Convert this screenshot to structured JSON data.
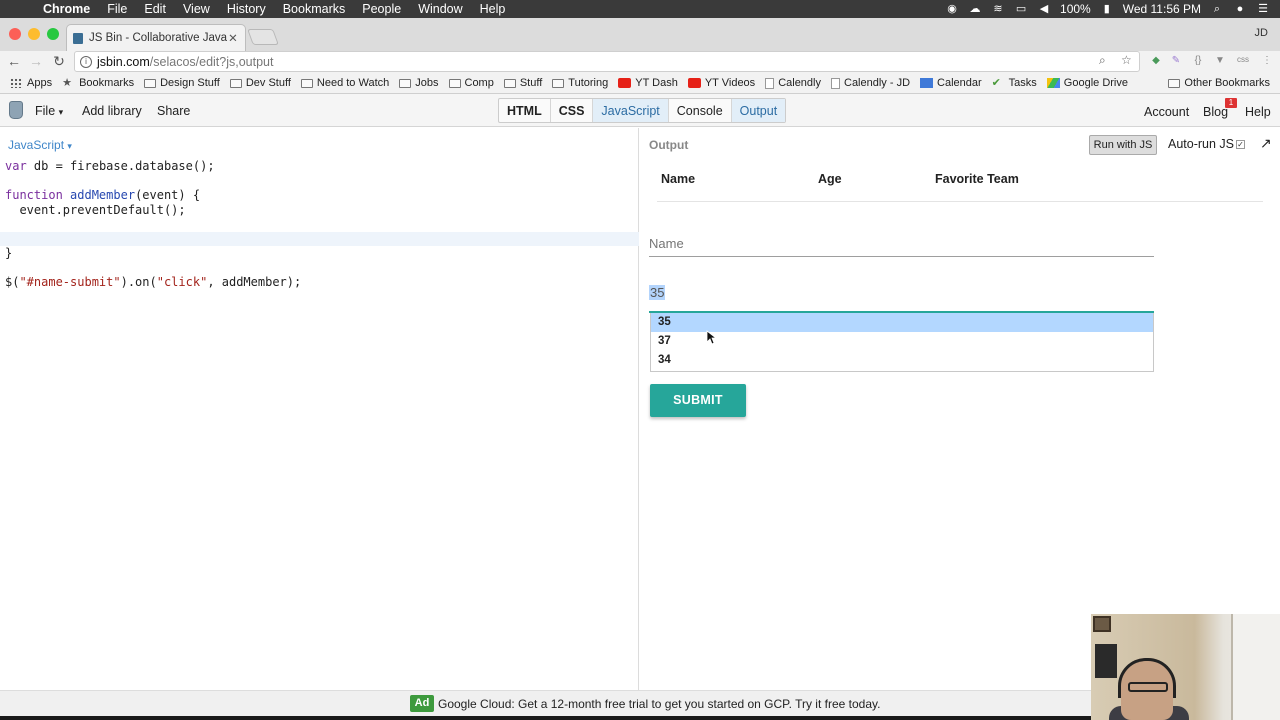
{
  "menubar": {
    "app": "Chrome",
    "items": [
      "File",
      "Edit",
      "View",
      "History",
      "Bookmarks",
      "People",
      "Window",
      "Help"
    ],
    "battery": "100%",
    "clock": "Wed 11:56 PM"
  },
  "browser": {
    "tab_title": "JS Bin - Collaborative JavaScr",
    "profile": "JD",
    "url_host": "jsbin.com",
    "url_path": "/selacos/edit?js,output"
  },
  "bookmarks": [
    {
      "label": "Apps",
      "icon": "apps-grid-icon"
    },
    {
      "label": "Bookmarks",
      "icon": "star-icon"
    },
    {
      "label": "Design Stuff",
      "icon": "folder-icon"
    },
    {
      "label": "Dev Stuff",
      "icon": "folder-icon"
    },
    {
      "label": "Need to Watch",
      "icon": "folder-icon"
    },
    {
      "label": "Jobs",
      "icon": "folder-icon"
    },
    {
      "label": "Comp",
      "icon": "folder-icon"
    },
    {
      "label": "Stuff",
      "icon": "folder-icon"
    },
    {
      "label": "Tutoring",
      "icon": "folder-icon"
    },
    {
      "label": "YT Dash",
      "icon": "youtube-icon"
    },
    {
      "label": "YT Videos",
      "icon": "youtube-icon"
    },
    {
      "label": "Calendly",
      "icon": "page-icon"
    },
    {
      "label": "Calendly - JD",
      "icon": "page-icon"
    },
    {
      "label": "Calendar",
      "icon": "calendar-icon"
    },
    {
      "label": "Tasks",
      "icon": "check-icon"
    },
    {
      "label": "Google Drive",
      "icon": "drive-icon"
    }
  ],
  "other_bookmarks": "Other Bookmarks",
  "jsbin": {
    "file_menu": "File",
    "add_library": "Add library",
    "share": "Share",
    "tabs": [
      "HTML",
      "CSS",
      "JavaScript",
      "Console",
      "Output"
    ],
    "account": "Account",
    "blog": "Blog",
    "blog_badge": "1",
    "help": "Help"
  },
  "editor": {
    "language": "JavaScript",
    "lines": [
      "var db = firebase.database();",
      "",
      "function addMember(event) {",
      "  event.preventDefault();",
      "",
      "",
      "}",
      "",
      "$(\"#name-submit\").on(\"click\", addMember);"
    ]
  },
  "output": {
    "label": "Output",
    "run_button": "Run with JS",
    "autorun": "Auto-run JS",
    "table_headers": [
      "Name",
      "Age",
      "Favorite Team"
    ],
    "name_placeholder": "Name",
    "age_selected": "35",
    "age_options": [
      "35",
      "37",
      "34"
    ],
    "submit": "SUBMIT"
  },
  "ad": {
    "badge": "Ad",
    "text": "Google Cloud: Get a 12-month free trial to get you started on GCP. Try it free today."
  },
  "colors": {
    "accent_teal": "#26a69a",
    "jsbin_tab_active": "#2c6ca3",
    "selection": "#b3d4fc"
  }
}
